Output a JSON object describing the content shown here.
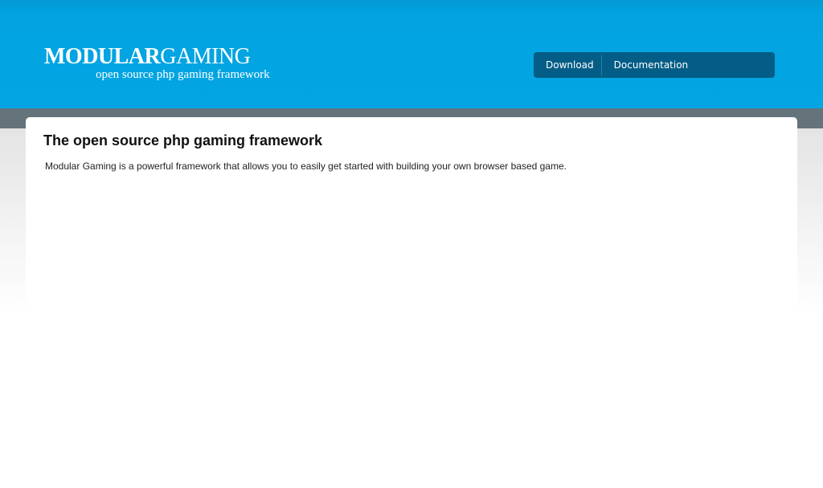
{
  "logo": {
    "title_bold": "MODULAR",
    "title_light": "GAMING",
    "tagline": "open source php gaming framework"
  },
  "nav": {
    "items": [
      {
        "label": "Download"
      },
      {
        "label": "Documentation"
      }
    ]
  },
  "main": {
    "heading": "The open source php gaming framework",
    "description": "Modular Gaming is a powerful framework that allows you to easily get started with building your own browser based game."
  },
  "colors": {
    "header": "#02a3e0",
    "nav_bar": "#035d86",
    "band": "#65737b"
  }
}
